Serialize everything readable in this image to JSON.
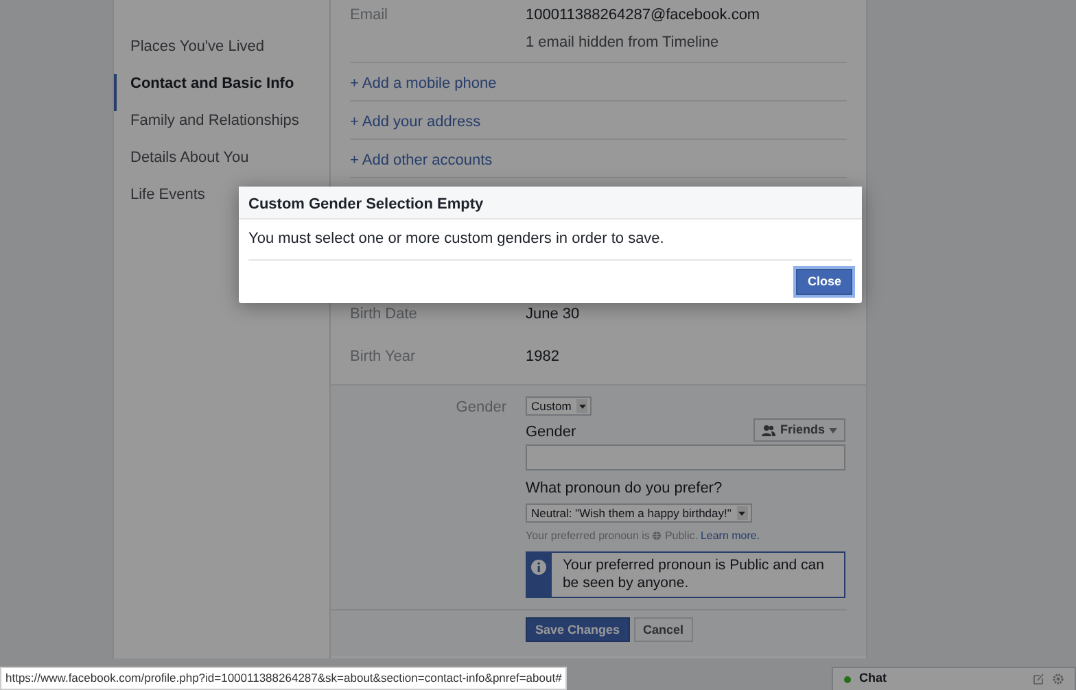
{
  "sidebar": {
    "items": [
      {
        "label": "Places You've Lived",
        "selected": false
      },
      {
        "label": "Contact and Basic Info",
        "selected": true
      },
      {
        "label": "Family and Relationships",
        "selected": false
      },
      {
        "label": "Details About You",
        "selected": false
      },
      {
        "label": "Life Events",
        "selected": false
      }
    ]
  },
  "contact": {
    "email": {
      "label": "Email",
      "value": "100011388264287@facebook.com",
      "note": "1 email hidden from Timeline"
    },
    "add_links": [
      "+ Add a mobile phone",
      "+ Add your address",
      "+ Add other accounts"
    ]
  },
  "basic_info": {
    "rows": [
      {
        "label": "Birth Date",
        "value": "June 30"
      },
      {
        "label": "Birth Year",
        "value": "1982"
      }
    ]
  },
  "gender_editor": {
    "label": "Gender",
    "select": "Custom",
    "field_label": "Gender",
    "audience": "Friends",
    "pronoun_question": "What pronoun do you prefer?",
    "pronoun_select": "Neutral: \"Wish them a happy birthday!\"",
    "hint": {
      "text": "Your preferred pronoun is",
      "audience": "Public.",
      "link": "Learn more."
    },
    "info": "Your preferred pronoun is Public and can be seen by anyone.",
    "buttons": [
      {
        "label": "Save Changes",
        "kind": "primary"
      },
      {
        "label": "Cancel",
        "kind": "secondary"
      }
    ]
  },
  "modal": {
    "title": "Custom Gender Selection Empty",
    "message": "You must select one or more custom genders in order to save.",
    "button": "Close"
  },
  "status_url": "https://www.facebook.com/profile.php?id=100011388264287&sk=about&section=contact-info&pnref=about#",
  "chat": {
    "label": "Chat"
  }
}
